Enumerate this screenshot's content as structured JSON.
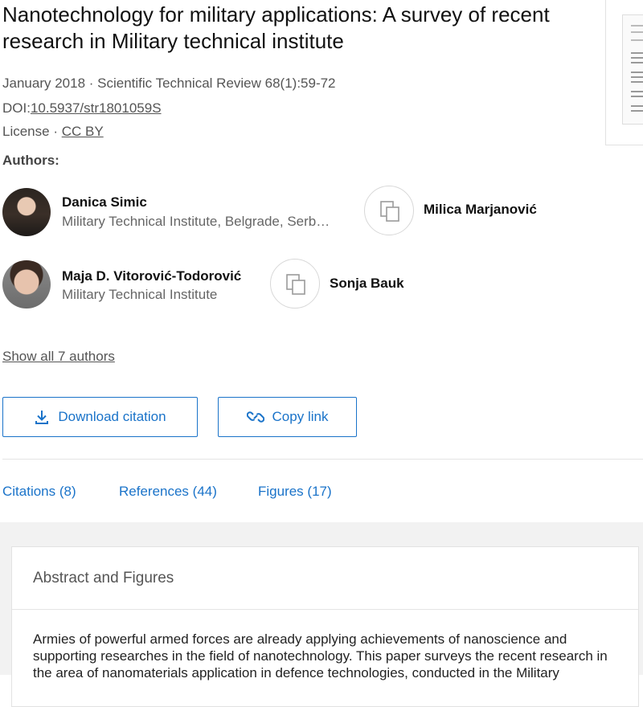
{
  "paper": {
    "title": "Nanotechnology for military applications: A survey of recent research in Military technical institute",
    "date_journal": "January 2018 · Scientific Technical Review 68(1):59-72",
    "doi_label": "DOI:",
    "doi_value": "10.5937/str1801059S",
    "license_label": "License · ",
    "license_value": "CC BY"
  },
  "authors": {
    "label": "Authors:",
    "list": [
      {
        "name": "Danica Simic",
        "affiliation": "Military Technical Institute, Belgrade, Serb…",
        "avatar": "photo"
      },
      {
        "name": "Milica Marjanović",
        "affiliation": "",
        "avatar": "placeholder-icon"
      },
      {
        "name": "Maja D. Vitorović-Todorović",
        "affiliation": "Military Technical Institute",
        "avatar": "photo"
      },
      {
        "name": "Sonja Bauk",
        "affiliation": "",
        "avatar": "placeholder-icon"
      }
    ],
    "show_all": "Show all 7 authors"
  },
  "actions": {
    "download_citation": "Download citation",
    "copy_link": "Copy link"
  },
  "tabs": [
    {
      "label": "Citations (8)"
    },
    {
      "label": "References (44)"
    },
    {
      "label": "Figures (17)"
    }
  ],
  "abstract": {
    "heading": "Abstract and Figures",
    "text": "Armies of powerful armed forces are already applying achievements of nanoscience and supporting researches in the field of nanotechnology. This paper surveys the recent research in the area of nanomaterials application in defence technologies, conducted in the Military"
  },
  "colors": {
    "accent": "#1a73c9",
    "muted_text": "#555555",
    "lower_background": "#f2f2f2"
  }
}
